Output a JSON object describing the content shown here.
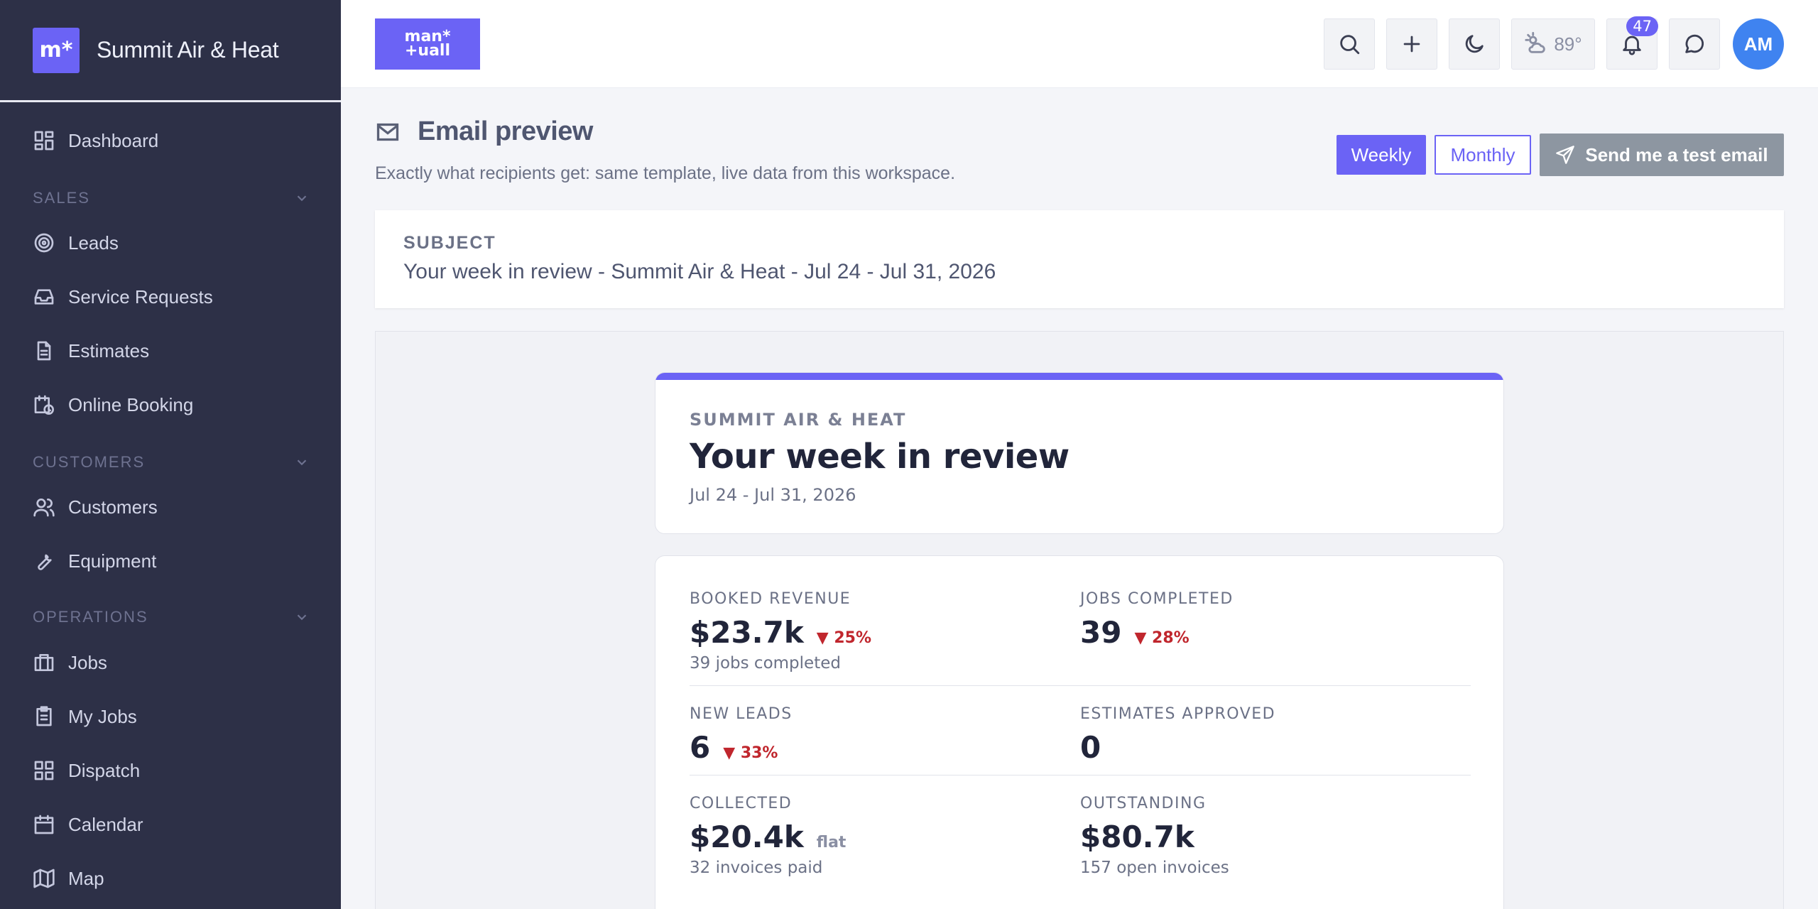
{
  "brand": {
    "logo_text": "m*",
    "name": "Summit Air & Heat"
  },
  "nav": {
    "dashboard": "Dashboard",
    "sections": {
      "sales": "SALES",
      "customers": "CUSTOMERS",
      "operations": "OPERATIONS"
    },
    "items": {
      "leads": "Leads",
      "service_requests": "Service Requests",
      "estimates": "Estimates",
      "online_booking": "Online Booking",
      "customers": "Customers",
      "equipment": "Equipment",
      "jobs": "Jobs",
      "my_jobs": "My Jobs",
      "dispatch": "Dispatch",
      "calendar": "Calendar",
      "map": "Map"
    }
  },
  "topbar": {
    "logo_line1": "man*",
    "logo_line2": "+uall",
    "weather_temp": "89°",
    "notification_count": "47",
    "avatar_initials": "AM"
  },
  "header": {
    "title": "Email preview",
    "subtitle": "Exactly what recipients get: same template, live data from this workspace.",
    "weekly_label": "Weekly",
    "monthly_label": "Monthly",
    "send_label": "Send me a test email"
  },
  "subject": {
    "label": "SUBJECT",
    "text": "Your week in review - Summit Air & Heat - Jul 24 - Jul 31, 2026"
  },
  "email": {
    "brand": "SUMMIT AIR & HEAT",
    "title": "Your week in review",
    "date_range": "Jul 24 - Jul 31, 2026",
    "stats": {
      "booked_revenue": {
        "label": "BOOKED REVENUE",
        "value": "$23.7k",
        "delta": "▼ 25%",
        "sub": "39 jobs completed"
      },
      "jobs_completed": {
        "label": "JOBS COMPLETED",
        "value": "39",
        "delta": "▼ 28%"
      },
      "new_leads": {
        "label": "NEW LEADS",
        "value": "6",
        "delta": "▼ 33%"
      },
      "estimates_approved": {
        "label": "ESTIMATES APPROVED",
        "value": "0"
      },
      "collected": {
        "label": "COLLECTED",
        "value": "$20.4k",
        "delta": "flat",
        "sub": "32 invoices paid"
      },
      "outstanding": {
        "label": "OUTSTANDING",
        "value": "$80.7k",
        "sub": "157 open invoices"
      }
    }
  },
  "colors": {
    "accent": "#6b63f5",
    "sidebar": "#2d3047",
    "negative": "#c0262d",
    "avatar": "#3f83f0"
  }
}
